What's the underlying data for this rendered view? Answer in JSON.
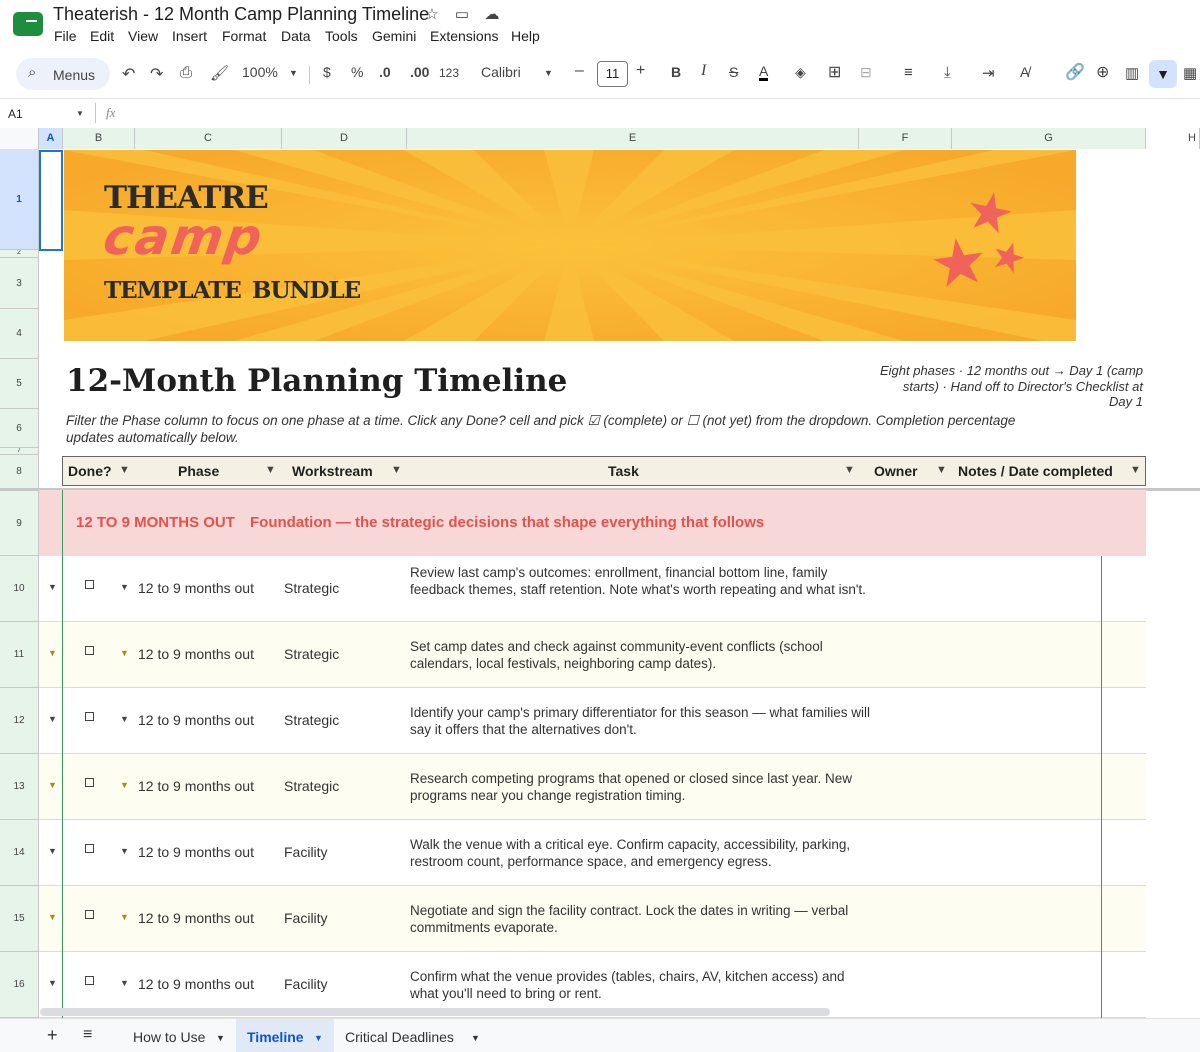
{
  "app": {
    "title": "Theaterish - 12 Month Camp Planning Timeline"
  },
  "menu": [
    "File",
    "Edit",
    "View",
    "Insert",
    "Format",
    "Data",
    "Tools",
    "Gemini",
    "Extensions",
    "Help"
  ],
  "toolbar": {
    "menus_label": "Menus",
    "zoom": "100%",
    "currency": "$",
    "percent": "%",
    "dec_less": ".0",
    "dec_more": ".00",
    "number_format": "123",
    "font": "Calibri",
    "font_size": "11"
  },
  "formula": {
    "cell_ref": "A1",
    "fx": "fx",
    "value": ""
  },
  "columns": [
    "A",
    "B",
    "C",
    "D",
    "E",
    "F",
    "G",
    "H"
  ],
  "rows_visible": [
    "1",
    "2",
    "3",
    "4",
    "5",
    "6",
    "7",
    "8",
    "9",
    "10",
    "11",
    "12",
    "13",
    "14",
    "15",
    "16"
  ],
  "banner": {
    "line1": "THEATRE",
    "line2": "camp",
    "line3": "TEMPLATE",
    "line3b": "BUNDLE"
  },
  "sheet": {
    "title": "12-Month Planning Timeline",
    "meta_line1": "Eight phases  ·  12 months out → Day 1 (camp",
    "meta_line2": "starts)  ·  Hand off to Director's Checklist at",
    "meta_line3": "Day 1",
    "instructions_1": "Filter the Phase column to focus on one phase at a time. Click any Done? cell and pick ☑ (complete) or ☐ (not yet) from the dropdown. Completion percentage",
    "instructions_2": "updates automatically below."
  },
  "table": {
    "headers": {
      "done": "Done?",
      "phase": "Phase",
      "workstream": "Workstream",
      "task": "Task",
      "owner": "Owner",
      "notes": "Notes / Date completed"
    },
    "phase_banner": {
      "label": "12 TO 9 MONTHS OUT",
      "desc": "Foundation — the strategic decisions that shape everything that follows"
    },
    "rows": [
      {
        "row": "10",
        "done": "☐",
        "phase": "12 to 9 months out",
        "workstream": "Strategic",
        "task": "Review last camp's outcomes: enrollment, financial bottom line, family feedback themes, staff retention. Note what's worth repeating and what isn't."
      },
      {
        "row": "11",
        "done": "☐",
        "phase": "12 to 9 months out",
        "workstream": "Strategic",
        "task": "Set camp dates and check against community-event conflicts (school calendars, local festivals, neighboring camp dates)."
      },
      {
        "row": "12",
        "done": "☐",
        "phase": "12 to 9 months out",
        "workstream": "Strategic",
        "task": "Identify your camp's primary differentiator for this season — what families will say it offers that the alternatives don't."
      },
      {
        "row": "13",
        "done": "☐",
        "phase": "12 to 9 months out",
        "workstream": "Strategic",
        "task": "Research competing programs that opened or closed since last year. New programs near you change registration timing."
      },
      {
        "row": "14",
        "done": "☐",
        "phase": "12 to 9 months out",
        "workstream": "Facility",
        "task": "Walk the venue with a critical eye. Confirm capacity, accessibility, parking, restroom count, performance space, and emergency egress."
      },
      {
        "row": "15",
        "done": "☐",
        "phase": "12 to 9 months out",
        "workstream": "Facility",
        "task": "Negotiate and sign the facility contract. Lock the dates in writing — verbal commitments evaporate."
      },
      {
        "row": "16",
        "done": "☐",
        "phase": "12 to 9 months out",
        "workstream": "Facility",
        "task": "Confirm what the venue provides (tables, chairs, AV, kitchen access) and what you'll need to bring or rent."
      }
    ]
  },
  "tabs": [
    "How to Use",
    "Timeline",
    "Critical Deadlines"
  ],
  "colors": {
    "accent": "#0b57d0",
    "banner": "#f7a92a",
    "phase_bg": "#f7d7d7",
    "phase_text": "#e8504a",
    "alt_row": "#fefdf2",
    "header_bg": "#f4f1e4"
  }
}
